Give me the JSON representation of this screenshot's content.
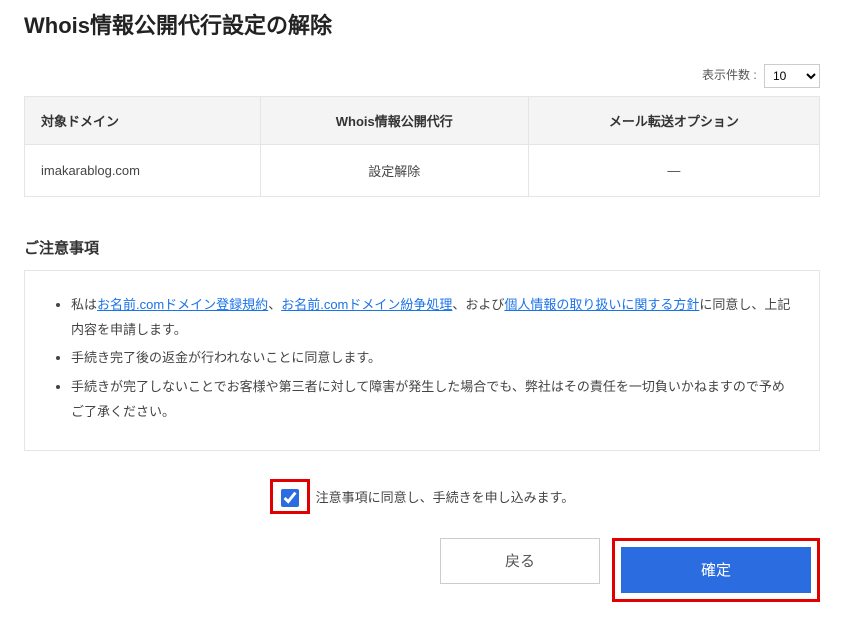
{
  "page_title": "Whois情報公開代行設定の解除",
  "display_count": {
    "label": "表示件数 :",
    "value": "10"
  },
  "table": {
    "headers": {
      "domain": "対象ドメイン",
      "whois": "Whois情報公開代行",
      "mail_forward": "メール転送オプション"
    },
    "rows": [
      {
        "domain": "imakarablog.com",
        "whois": "設定解除",
        "mail_forward": "—"
      }
    ]
  },
  "notice": {
    "heading": "ご注意事項",
    "item1_pre": "私は",
    "item1_link1": "お名前.comドメイン登録規約",
    "item1_sep1": "、",
    "item1_link2": "お名前.comドメイン紛争処理",
    "item1_sep2": "、および",
    "item1_link3": "個人情報の取り扱いに関する方針",
    "item1_post": "に同意し、上記内容を申請します。",
    "item2": "手続き完了後の返金が行われないことに同意します。",
    "item3": "手続きが完了しないことでお客様や第三者に対して障害が発生した場合でも、弊社はその責任を一切負いかねますので予めご了承ください。"
  },
  "consent": {
    "label": "注意事項に同意し、手続きを申し込みます。"
  },
  "buttons": {
    "back": "戻る",
    "confirm": "確定"
  }
}
